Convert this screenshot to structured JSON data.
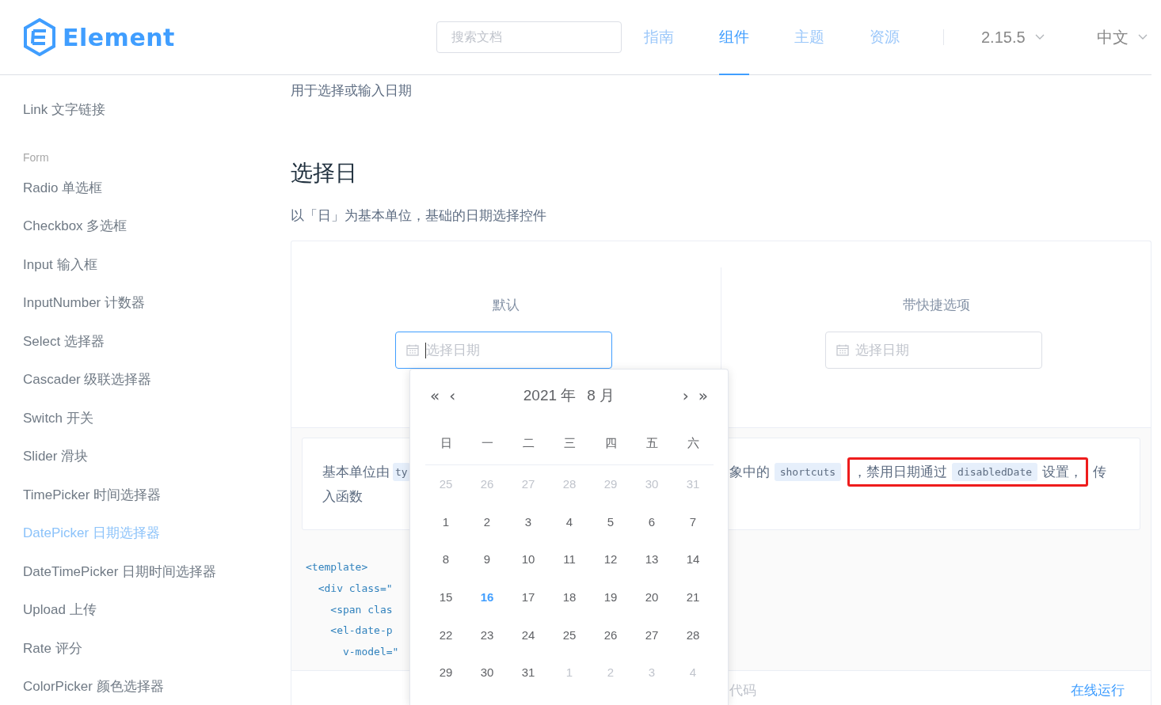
{
  "header": {
    "logo": "Element",
    "search": {
      "placeholder": "搜索文档"
    },
    "nav": [
      {
        "label": "指南",
        "selected": false
      },
      {
        "label": "组件",
        "selected": true
      },
      {
        "label": "主题",
        "selected": false
      },
      {
        "label": "资源",
        "selected": false
      }
    ],
    "version": "2.15.5",
    "language": "中文"
  },
  "sidebar": {
    "items": [
      {
        "label": "Link 文字链接",
        "kind": "item",
        "selected": false
      },
      {
        "label": "Form",
        "kind": "group"
      },
      {
        "label": "Radio 单选框",
        "kind": "item",
        "selected": false
      },
      {
        "label": "Checkbox 多选框",
        "kind": "item",
        "selected": false
      },
      {
        "label": "Input 输入框",
        "kind": "item",
        "selected": false
      },
      {
        "label": "InputNumber 计数器",
        "kind": "item",
        "selected": false
      },
      {
        "label": "Select 选择器",
        "kind": "item",
        "selected": false
      },
      {
        "label": "Cascader 级联选择器",
        "kind": "item",
        "selected": false
      },
      {
        "label": "Switch 开关",
        "kind": "item",
        "selected": false
      },
      {
        "label": "Slider 滑块",
        "kind": "item",
        "selected": false
      },
      {
        "label": "TimePicker 时间选择器",
        "kind": "item",
        "selected": false
      },
      {
        "label": "DatePicker 日期选择器",
        "kind": "item",
        "selected": true
      },
      {
        "label": "DateTimePicker 日期时间选择器",
        "kind": "item",
        "selected": false
      },
      {
        "label": "Upload 上传",
        "kind": "item",
        "selected": false
      },
      {
        "label": "Rate 评分",
        "kind": "item",
        "selected": false
      },
      {
        "label": "ColorPicker 颜色选择器",
        "kind": "item",
        "selected": false
      }
    ]
  },
  "page": {
    "intro": "用于选择或输入日期",
    "section_title": "选择日",
    "section_desc": "以「日」为基本单位，基础的日期选择控件"
  },
  "demo": {
    "columns": [
      {
        "label": "默认",
        "placeholder": "选择日期",
        "focused": true
      },
      {
        "label": "带快捷选项",
        "placeholder": "选择日期",
        "focused": false
      }
    ],
    "description": {
      "left": [
        {
          "kind": "text",
          "text": "基本单位由"
        },
        {
          "kind": "code",
          "text": "ty"
        }
      ],
      "right": [
        {
          "kind": "text",
          "text": "象中的"
        },
        {
          "kind": "code",
          "text": "shortcuts"
        }
      ],
      "boxed": [
        {
          "kind": "text",
          "text": "，禁用日期通过"
        },
        {
          "kind": "code",
          "text": "disabledDate"
        },
        {
          "kind": "text",
          "text": "设置，"
        }
      ],
      "after": [
        {
          "kind": "text",
          "text": "传"
        }
      ],
      "line_2": "入函数"
    },
    "code_lines": [
      "<template>",
      "  <div class=\"",
      "    <span clas",
      "    <el-date-p",
      "      v-model=\""
    ],
    "footer": {
      "show_code": "代码",
      "run_online": "在线运行"
    }
  },
  "popup": {
    "prev_year": "«",
    "prev_month": "‹",
    "year": "2021 年",
    "month": "8 月",
    "next_month": "›",
    "next_year": "»",
    "weekdays": [
      "日",
      "一",
      "二",
      "三",
      "四",
      "五",
      "六"
    ],
    "weeks": [
      [
        {
          "day": "25",
          "kind": "other"
        },
        {
          "day": "26",
          "kind": "other"
        },
        {
          "day": "27",
          "kind": "other"
        },
        {
          "day": "28",
          "kind": "other"
        },
        {
          "day": "29",
          "kind": "other"
        },
        {
          "day": "30",
          "kind": "other"
        },
        {
          "day": "31",
          "kind": "other"
        }
      ],
      [
        {
          "day": "1",
          "kind": "current"
        },
        {
          "day": "2",
          "kind": "current"
        },
        {
          "day": "3",
          "kind": "current"
        },
        {
          "day": "4",
          "kind": "current"
        },
        {
          "day": "5",
          "kind": "current"
        },
        {
          "day": "6",
          "kind": "current"
        },
        {
          "day": "7",
          "kind": "current"
        }
      ],
      [
        {
          "day": "8",
          "kind": "current"
        },
        {
          "day": "9",
          "kind": "current"
        },
        {
          "day": "10",
          "kind": "current"
        },
        {
          "day": "11",
          "kind": "current"
        },
        {
          "day": "12",
          "kind": "current"
        },
        {
          "day": "13",
          "kind": "current"
        },
        {
          "day": "14",
          "kind": "current"
        }
      ],
      [
        {
          "day": "15",
          "kind": "current"
        },
        {
          "day": "16",
          "kind": "today"
        },
        {
          "day": "17",
          "kind": "current"
        },
        {
          "day": "18",
          "kind": "current"
        },
        {
          "day": "19",
          "kind": "current"
        },
        {
          "day": "20",
          "kind": "current"
        },
        {
          "day": "21",
          "kind": "current"
        }
      ],
      [
        {
          "day": "22",
          "kind": "current"
        },
        {
          "day": "23",
          "kind": "current"
        },
        {
          "day": "24",
          "kind": "current"
        },
        {
          "day": "25",
          "kind": "current"
        },
        {
          "day": "26",
          "kind": "current"
        },
        {
          "day": "27",
          "kind": "current"
        },
        {
          "day": "28",
          "kind": "current"
        }
      ],
      [
        {
          "day": "29",
          "kind": "current"
        },
        {
          "day": "30",
          "kind": "current"
        },
        {
          "day": "31",
          "kind": "current"
        },
        {
          "day": "1",
          "kind": "other"
        },
        {
          "day": "2",
          "kind": "other"
        },
        {
          "day": "3",
          "kind": "other"
        },
        {
          "day": "4",
          "kind": "other"
        }
      ]
    ]
  }
}
